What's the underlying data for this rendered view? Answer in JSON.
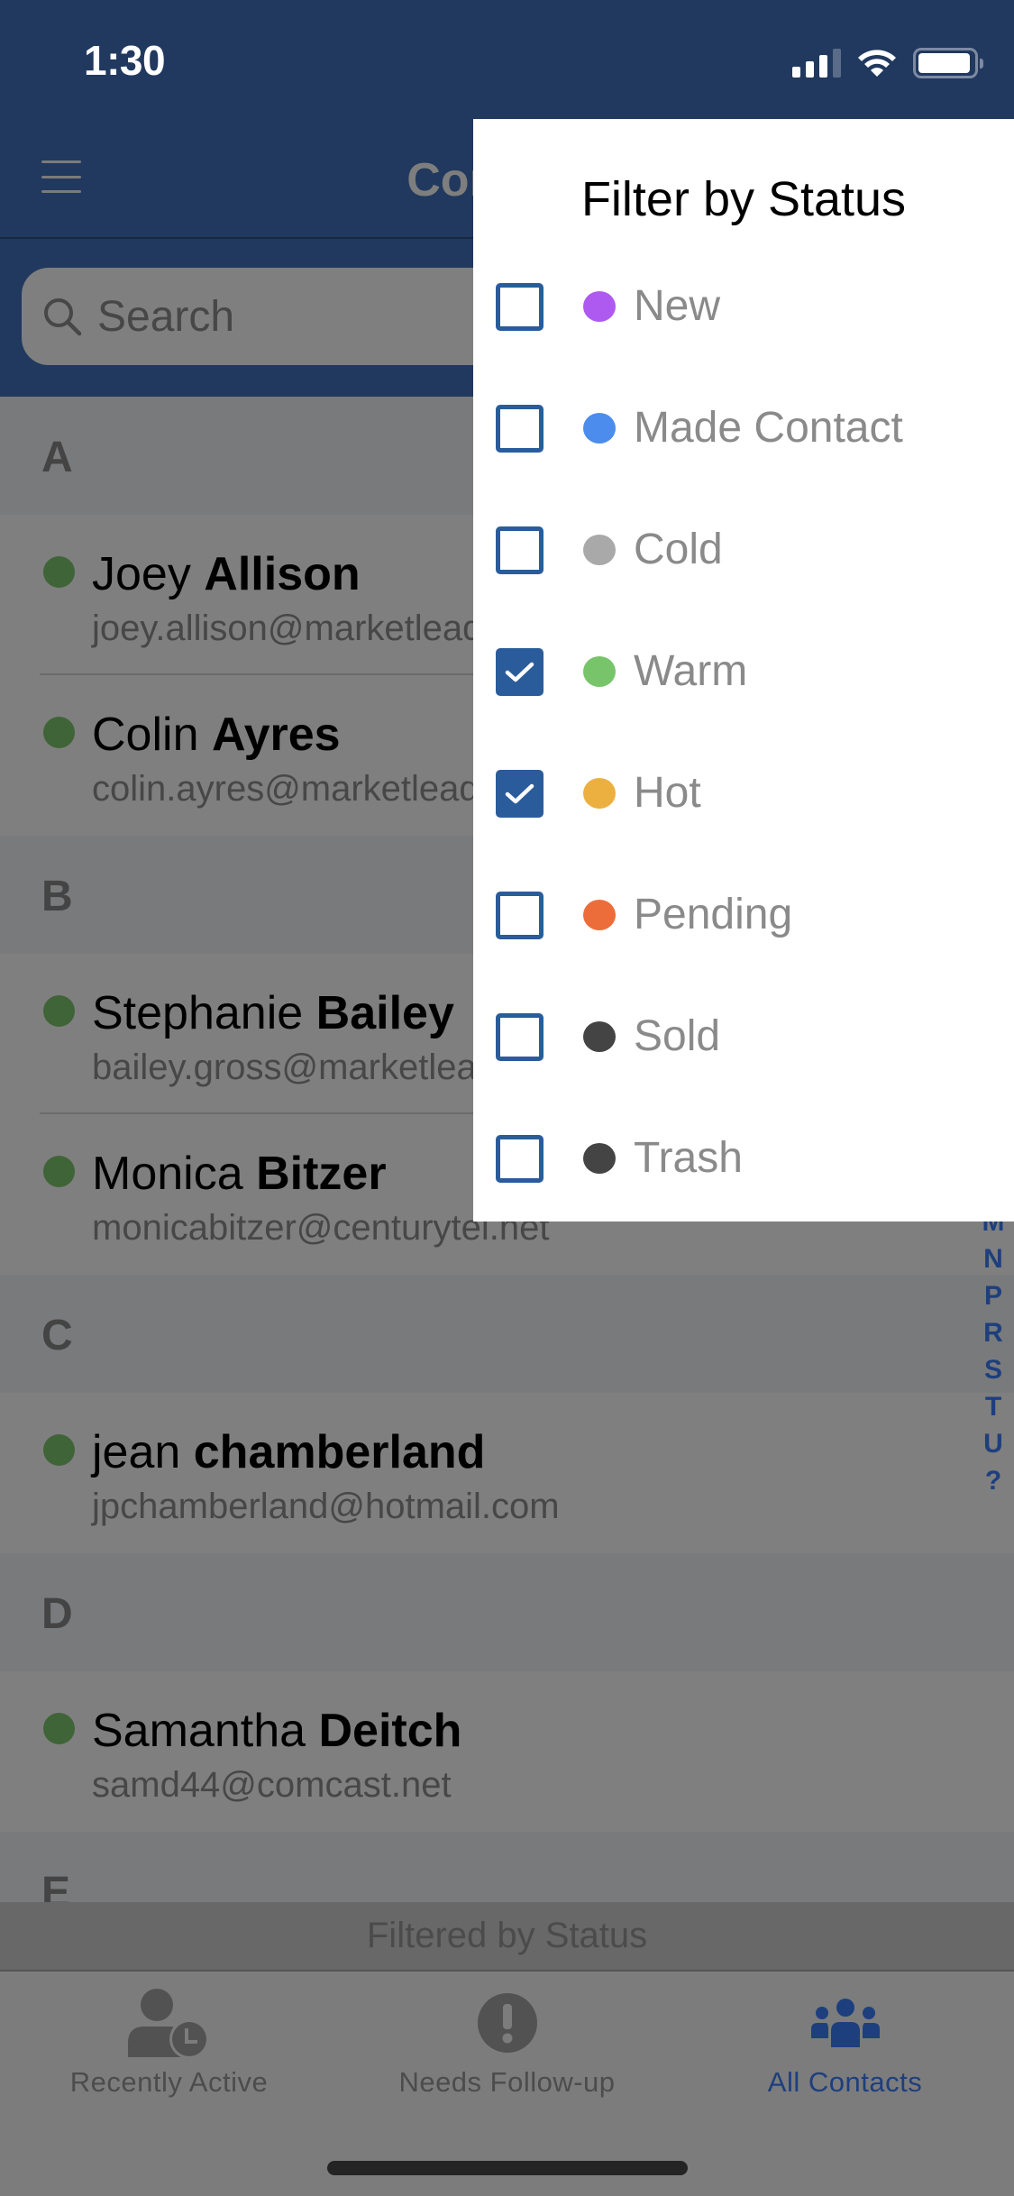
{
  "status_bar": {
    "time": "1:30",
    "signal_bars": 3,
    "signal_bars_total": 4,
    "battery_level": 0.95
  },
  "nav": {
    "menu_icon": "hamburger-icon",
    "title": "Contacts"
  },
  "search": {
    "icon": "search-icon",
    "placeholder": "Search",
    "value": ""
  },
  "sections": [
    {
      "letter": "A",
      "contacts": [
        {
          "first": "Joey",
          "last": "Allison",
          "email": "joey.allison@marketleader.com",
          "status_color": "#3f6437"
        },
        {
          "first": "Colin",
          "last": "Ayres",
          "email": "colin.ayres@marketleader.com",
          "status_color": "#3f6437"
        }
      ]
    },
    {
      "letter": "B",
      "contacts": [
        {
          "first": "Stephanie",
          "last": "Bailey",
          "email": "bailey.gross@marketleader.com",
          "status_color": "#3f6437"
        },
        {
          "first": "Monica",
          "last": "Bitzer",
          "email": "monicabitzer@centurytel.net",
          "status_color": "#3f6437"
        }
      ]
    },
    {
      "letter": "C",
      "contacts": [
        {
          "first": "jean",
          "last": "chamberland",
          "email": "jpchamberland@hotmail.com",
          "status_color": "#3f6437"
        }
      ]
    },
    {
      "letter": "D",
      "contacts": [
        {
          "first": "Samantha",
          "last": "Deitch",
          "email": "samd44@comcast.net",
          "status_color": "#3f6437"
        }
      ]
    },
    {
      "letter": "E",
      "contacts": []
    }
  ],
  "index_letters": [
    "M",
    "N",
    "P",
    "R",
    "S",
    "T",
    "U",
    "?"
  ],
  "filtered_banner": "Filtered by Status",
  "tabs": [
    {
      "label": "Recently Active",
      "icon": "user-clock-icon",
      "active": false
    },
    {
      "label": "Needs Follow-up",
      "icon": "exclamation-circle-icon",
      "active": false
    },
    {
      "label": "All Contacts",
      "icon": "users-icon",
      "active": true
    }
  ],
  "filter_panel": {
    "title": "Filter by Status",
    "accent_color": "#2a5c9b",
    "options": [
      {
        "label": "New",
        "color": "#ae59f0",
        "checked": false
      },
      {
        "label": "Made Contact",
        "color": "#4b8ced",
        "checked": false
      },
      {
        "label": "Cold",
        "color": "#a9a9a9",
        "checked": false
      },
      {
        "label": "Warm",
        "color": "#78c46a",
        "checked": true
      },
      {
        "label": "Hot",
        "color": "#ecb040",
        "checked": true
      },
      {
        "label": "Pending",
        "color": "#ec6d39",
        "checked": false
      },
      {
        "label": "Sold",
        "color": "#444444",
        "checked": false
      },
      {
        "label": "Trash",
        "color": "#444444",
        "checked": false
      }
    ]
  }
}
